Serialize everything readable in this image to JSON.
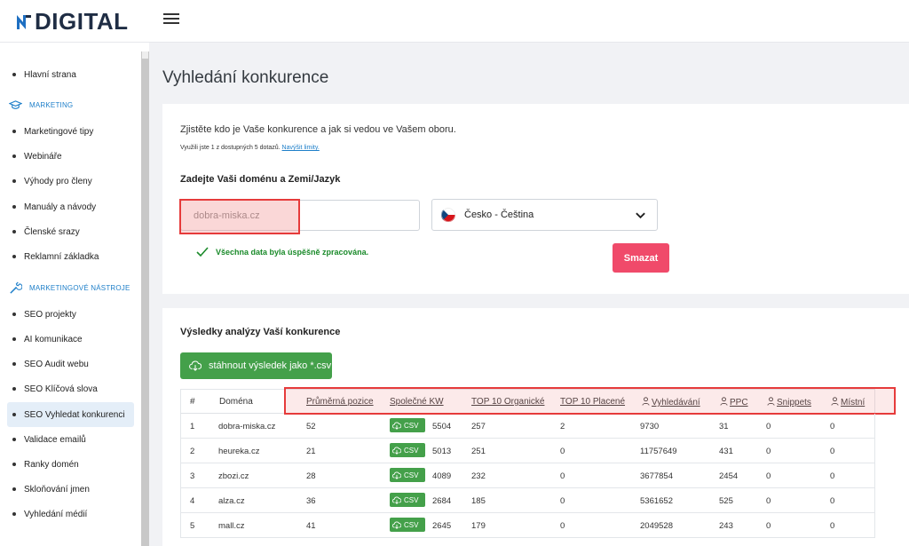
{
  "logo": {
    "text": "DIGITAL"
  },
  "sidebar": {
    "items": [
      {
        "label": "Hlavní strana"
      },
      {
        "label": "Marketingové tipy"
      },
      {
        "label": "Webináře"
      },
      {
        "label": "Výhody pro členy"
      },
      {
        "label": "Manuály a návody"
      },
      {
        "label": "Členské srazy"
      },
      {
        "label": "Reklamní základka"
      },
      {
        "label": "SEO projekty"
      },
      {
        "label": "AI komunikace"
      },
      {
        "label": "SEO Audit webu"
      },
      {
        "label": "SEO Klíčová slova"
      },
      {
        "label": "SEO Vyhledat konkurenci",
        "active": true
      },
      {
        "label": "Validace emailů"
      },
      {
        "label": "Ranky domén"
      },
      {
        "label": "Skloňování jmen"
      },
      {
        "label": "Vyhledání médií"
      }
    ],
    "sections": [
      {
        "label": "MARKETING"
      },
      {
        "label": "MARKETINGOVÉ NÁSTROJE"
      }
    ]
  },
  "page": {
    "title": "Vyhledání konkurence"
  },
  "search": {
    "intro": "Zjistěte kdo je Vaše konkurence a jak si vedou ve Vašem oboru.",
    "usage_text": "Využili jste 1 z dostupných 5 dotazů.",
    "usage_link": "Navýšit limity.",
    "label": "Zadejte Vaši doménu a Zemi/Jazyk",
    "domain_value": "dobra-miska.cz",
    "language": "Česko - Čeština",
    "success": "Všechna data byla úspěšně zpracována.",
    "clear_button": "Smazat"
  },
  "results": {
    "title": "Výsledky analýzy Vaší konkurence",
    "download_button": "stáhnout výsledek jako *.csv",
    "csv_label": "CSV",
    "headers": [
      "#",
      "Doména",
      "Průměrná pozice",
      "Společné KW",
      "TOP 10 Organické",
      "TOP 10 Placené",
      "Vyhledávání",
      "PPC",
      "Snippets",
      "Místní"
    ],
    "rows": [
      {
        "num": "1",
        "domain": "dobra-miska.cz",
        "avg_pos": "52",
        "common_kw": "5504",
        "top10_org": "257",
        "top10_paid": "2",
        "search": "9730",
        "ppc": "31",
        "snippets": "0",
        "local": "0"
      },
      {
        "num": "2",
        "domain": "heureka.cz",
        "avg_pos": "21",
        "common_kw": "5013",
        "top10_org": "251",
        "top10_paid": "0",
        "search": "11757649",
        "ppc": "431",
        "snippets": "0",
        "local": "0"
      },
      {
        "num": "3",
        "domain": "zbozi.cz",
        "avg_pos": "28",
        "common_kw": "4089",
        "top10_org": "232",
        "top10_paid": "0",
        "search": "3677854",
        "ppc": "2454",
        "snippets": "0",
        "local": "0"
      },
      {
        "num": "4",
        "domain": "alza.cz",
        "avg_pos": "36",
        "common_kw": "2684",
        "top10_org": "185",
        "top10_paid": "0",
        "search": "5361652",
        "ppc": "525",
        "snippets": "0",
        "local": "0"
      },
      {
        "num": "5",
        "domain": "mall.cz",
        "avg_pos": "41",
        "common_kw": "2645",
        "top10_org": "179",
        "top10_paid": "0",
        "search": "2049528",
        "ppc": "243",
        "snippets": "0",
        "local": "0"
      }
    ]
  },
  "colors": {
    "accent": "#1e7fc9",
    "danger": "#f04a6a",
    "success": "#44a04a",
    "highlight": "#e63b3b"
  }
}
